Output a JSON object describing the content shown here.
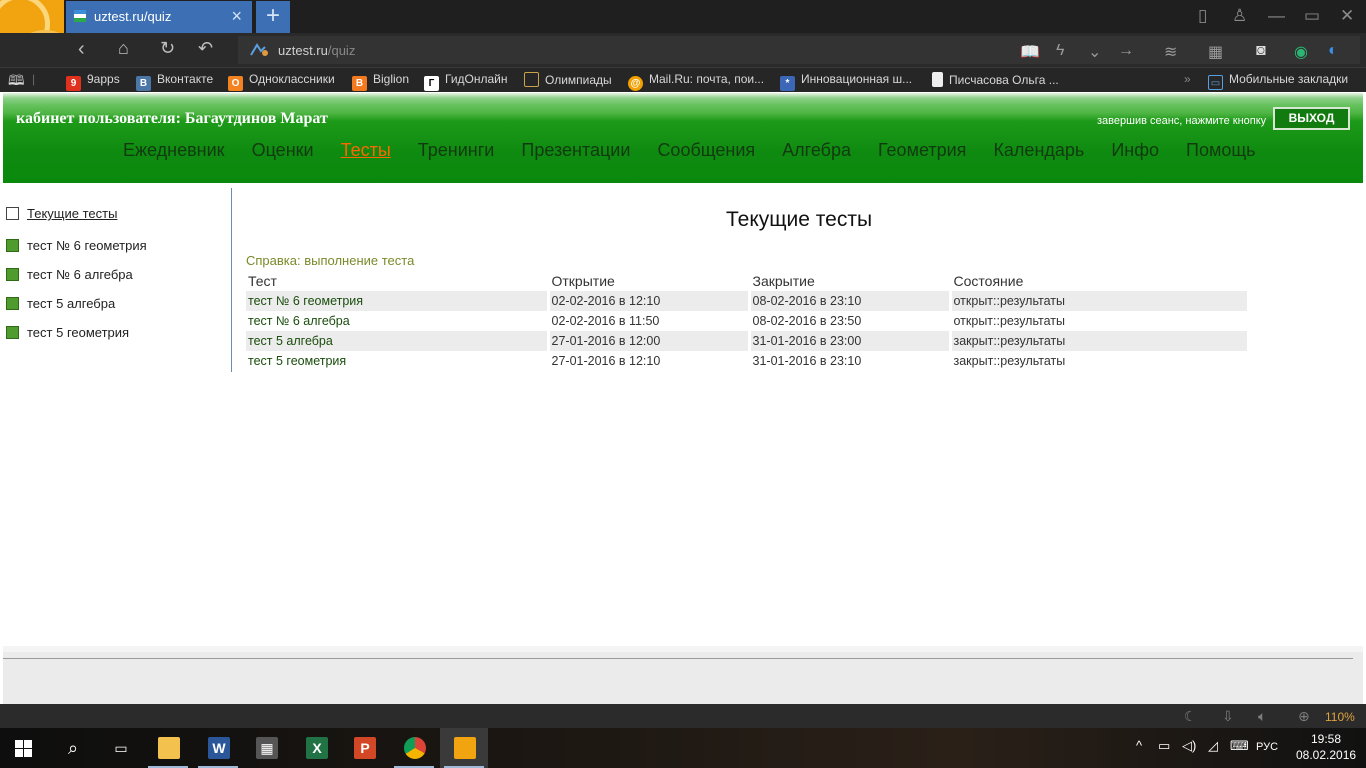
{
  "browser": {
    "tab_title": "uztest.ru/quiz",
    "url_host": "uztest.ru",
    "url_path": "/quiz",
    "bookmarks": [
      {
        "label": "9apps",
        "color": "#e0301e",
        "glyph": "9"
      },
      {
        "label": "Вконтакте",
        "color": "#4a76a8",
        "glyph": "B"
      },
      {
        "label": "Одноклассники",
        "color": "#f58220",
        "glyph": "O"
      },
      {
        "label": "Biglion",
        "color": "#f47a20",
        "glyph": "B"
      },
      {
        "label": "ГидОнлайн",
        "color": "#2a2a2a",
        "glyph": "Г"
      },
      {
        "label": "Олимпиады",
        "color": "#caa248",
        "glyph": ""
      },
      {
        "label": "Mail.Ru: почта, пои...",
        "color": "#f2a100",
        "glyph": "@"
      },
      {
        "label": "Инновационная ш...",
        "color": "#3b67b6",
        "glyph": "*"
      },
      {
        "label": "Писчасова Ольга ...",
        "color": "#eeeeee",
        "glyph": ""
      }
    ],
    "mobile_bookmarks": "Мобильные закладки",
    "zoom": "110%"
  },
  "page": {
    "cabinet_title": "кабинет пользователя: Багаутдинов Марат",
    "logout_hint": "завершив сеанс, нажмите кнопку",
    "logout_label": "ВЫХОД",
    "nav": [
      {
        "label": "Ежедневник",
        "active": false
      },
      {
        "label": "Оценки",
        "active": false
      },
      {
        "label": "Тесты",
        "active": true
      },
      {
        "label": "Тренинги",
        "active": false
      },
      {
        "label": "Презентации",
        "active": false
      },
      {
        "label": "Сообщения",
        "active": false
      },
      {
        "label": "Алгебра",
        "active": false
      },
      {
        "label": "Геометрия",
        "active": false
      },
      {
        "label": "Календарь",
        "active": false
      },
      {
        "label": "Инфо",
        "active": false
      },
      {
        "label": "Помощь",
        "active": false
      }
    ],
    "sidebar": {
      "heading": "Текущие тесты",
      "items": [
        "тест № 6 геометрия",
        "тест № 6 алгебра",
        "тест 5 алгебра",
        "тест 5 геометрия"
      ]
    },
    "content": {
      "title": "Текущие тесты",
      "help_prefix": "Справка:",
      "help_link": "выполнение теста",
      "columns": [
        "Тест",
        "Открытие",
        "Закрытие",
        "Состояние"
      ],
      "rows": [
        {
          "name": "тест № 6 геометрия",
          "open": "02-02-2016 в 12:10",
          "close": "08-02-2016 в 23:10",
          "status": "открыт::результаты"
        },
        {
          "name": "тест № 6 алгебра",
          "open": "02-02-2016 в 11:50",
          "close": "08-02-2016 в 23:50",
          "status": "открыт::результаты"
        },
        {
          "name": "тест 5 алгебра",
          "open": "27-01-2016 в 12:00",
          "close": "31-01-2016 в 23:00",
          "status": "закрыт::результаты"
        },
        {
          "name": "тест 5 геометрия",
          "open": "27-01-2016 в 12:10",
          "close": "31-01-2016 в 23:10",
          "status": "закрыт::результаты"
        }
      ]
    }
  },
  "taskbar": {
    "language": "РУС",
    "time": "19:58",
    "date": "08.02.2016"
  }
}
